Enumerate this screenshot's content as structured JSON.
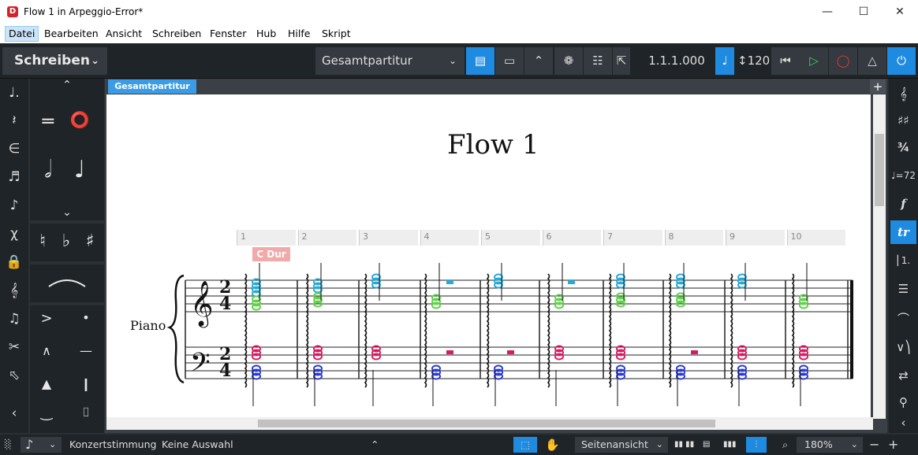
{
  "window": {
    "title": "Flow 1 in Arpeggio-Error*"
  },
  "menu": [
    "Datei",
    "Bearbeiten",
    "Ansicht",
    "Schreiben",
    "Fenster",
    "Hub",
    "Hilfe",
    "Skript"
  ],
  "toolbar": {
    "mode": "Schreiben",
    "layout": "Gesamtpartitur",
    "position": "1.1.1.000",
    "tempo": "120"
  },
  "tab": "Gesamtpartitur",
  "score": {
    "title": "Flow 1",
    "instrument": "Piano",
    "key_signpost": "C Dur",
    "time_signature": [
      "2",
      "4"
    ],
    "bar_numbers": [
      "1",
      "2",
      "3",
      "4",
      "5",
      "6",
      "7",
      "8",
      "9",
      "10"
    ]
  },
  "status": {
    "pitch": "Konzertstimmung",
    "selection": "Keine Auswahl",
    "view": "Seitenansicht",
    "zoom": "180%"
  },
  "colors": {
    "accent": "#1f8be0",
    "note_cyan": "#29a9d6",
    "note_green": "#5fd14a",
    "note_pink": "#d81b60",
    "note_blue": "#2a3bd6"
  }
}
